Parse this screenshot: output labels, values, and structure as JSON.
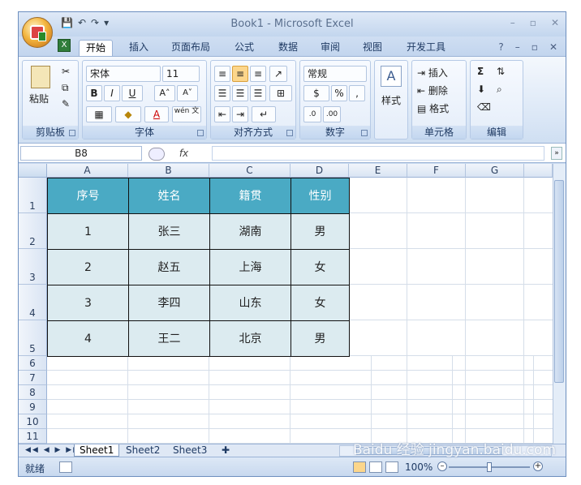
{
  "window": {
    "title": "Book1 - Microsoft Excel"
  },
  "qat": {
    "save_icon": "save-icon",
    "undo": "↶",
    "redo": "↷",
    "customize": "▾"
  },
  "tabs": [
    "开始",
    "插入",
    "页面布局",
    "公式",
    "数据",
    "审阅",
    "视图",
    "开发工具"
  ],
  "ribbon": {
    "clipboard": {
      "name": "剪贴板",
      "paste": "粘贴"
    },
    "font": {
      "name": "字体",
      "family": "宋体",
      "size": "11",
      "bold": "B",
      "italic": "I",
      "underline": "U",
      "grow": "A˄",
      "shrink": "A˅",
      "wen": "wén 文"
    },
    "align": {
      "name": "对齐方式"
    },
    "number": {
      "name": "数字",
      "format": "常规",
      "percent": "%",
      "comma": ","
    },
    "styles": {
      "name": "样式",
      "label": "样式"
    },
    "cells": {
      "name": "单元格",
      "insert": "插入",
      "delete": "删除",
      "format": "格式"
    },
    "edit": {
      "name": "编辑",
      "sum": "Σ"
    }
  },
  "formula_bar": {
    "name_box": "B8",
    "fx": "fx",
    "value": ""
  },
  "columns": [
    "A",
    "B",
    "C",
    "D",
    "E",
    "F",
    "G"
  ],
  "rows": [
    "1",
    "2",
    "3",
    "4",
    "5",
    "6",
    "7",
    "8",
    "9",
    "10",
    "11"
  ],
  "table": {
    "headers": [
      "序号",
      "姓名",
      "籍贯",
      "性别"
    ],
    "rows": [
      [
        "1",
        "张三",
        "湖南",
        "男"
      ],
      [
        "2",
        "赵五",
        "上海",
        "女"
      ],
      [
        "3",
        "李四",
        "山东",
        "女"
      ],
      [
        "4",
        "王二",
        "北京",
        "男"
      ]
    ]
  },
  "sheets": [
    "Sheet1",
    "Sheet2",
    "Sheet3"
  ],
  "status": {
    "ready": "就绪",
    "zoom": "100%"
  },
  "watermark": "Baidu 经验 jingyan.baidu.com"
}
